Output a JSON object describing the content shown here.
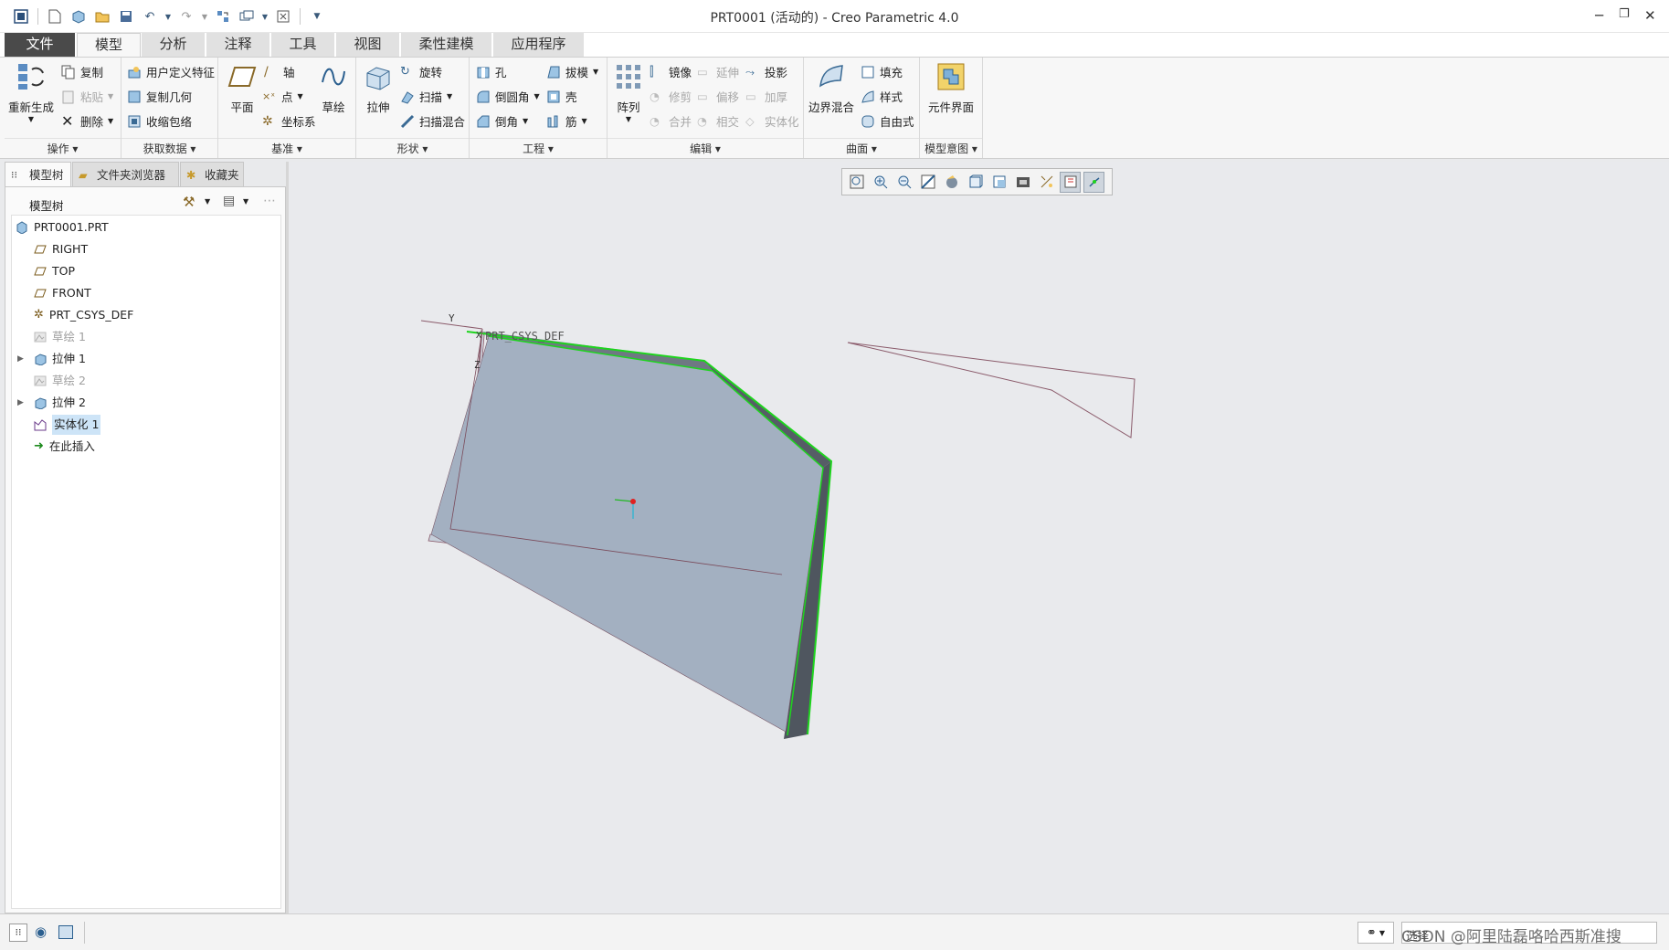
{
  "window": {
    "title": "PRT0001 (活动的) - Creo Parametric 4.0"
  },
  "tabs": [
    "文件",
    "模型",
    "分析",
    "注释",
    "工具",
    "视图",
    "柔性建模",
    "应用程序"
  ],
  "ribbon": {
    "ops": {
      "title": "操作",
      "regen": "重新生成",
      "copy": "复制",
      "paste": "粘贴",
      "delete": "删除"
    },
    "getdata": {
      "title": "获取数据",
      "udf": "用户定义特征",
      "copygeom": "复制几何",
      "shrinkwrap": "收缩包络"
    },
    "datum": {
      "title": "基准",
      "plane": "平面",
      "axis": "轴",
      "point": "点",
      "csys": "坐标系",
      "sketch": "草绘"
    },
    "shapes": {
      "title": "形状",
      "extrude": "拉伸",
      "revolve": "旋转",
      "sweep": "扫描",
      "swept_blend": "扫描混合"
    },
    "engineering": {
      "title": "工程",
      "hole": "孔",
      "round": "倒圆角",
      "chamfer": "倒角",
      "draft": "拔模",
      "shell": "壳",
      "rib": "筋"
    },
    "editing": {
      "title": "编辑",
      "pattern": "阵列",
      "mirror": "镜像",
      "extend": "延伸",
      "project": "投影",
      "trim": "修剪",
      "offset": "偏移",
      "thicken": "加厚",
      "merge": "合并",
      "intersect": "相交",
      "solidify": "实体化"
    },
    "surfaces": {
      "title": "曲面",
      "boundary": "边界混合",
      "fill": "填充",
      "style": "样式",
      "freestyle": "自由式"
    },
    "intent": {
      "title": "模型意图",
      "component_interface": "元件界面"
    }
  },
  "left_tabs": [
    "模型树",
    "文件夹浏览器",
    "收藏夹"
  ],
  "tree": {
    "header": "模型树",
    "items": [
      {
        "label": "PRT0001.PRT",
        "icon": "part-icon",
        "state": "normal"
      },
      {
        "label": "RIGHT",
        "icon": "datum-plane-icon",
        "state": "normal"
      },
      {
        "label": "TOP",
        "icon": "datum-plane-icon",
        "state": "normal"
      },
      {
        "label": "FRONT",
        "icon": "datum-plane-icon",
        "state": "normal"
      },
      {
        "label": "PRT_CSYS_DEF",
        "icon": "csys-icon",
        "state": "normal"
      },
      {
        "label": "草绘 1",
        "icon": "sketch-icon",
        "state": "dimmed"
      },
      {
        "label": "拉伸 1",
        "icon": "extrude-icon",
        "state": "normal"
      },
      {
        "label": "草绘 2",
        "icon": "sketch-icon",
        "state": "dimmed"
      },
      {
        "label": "拉伸 2",
        "icon": "extrude-icon",
        "state": "normal"
      },
      {
        "label": "实体化 1",
        "icon": "solidify-icon",
        "state": "selected"
      },
      {
        "label": "在此插入",
        "icon": "insert-arrow-icon",
        "state": "normal"
      }
    ]
  },
  "viewport": {
    "csys_label": "PRT_CSYS_DEF",
    "axis_y": "Y",
    "axis_z": "Z",
    "axis_x": "X"
  },
  "status": {
    "filter": "选择",
    "watermark": "CSDN @阿里陆磊咯哈西斯准搜"
  }
}
